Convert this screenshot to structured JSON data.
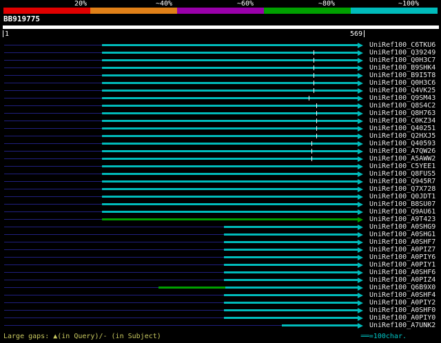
{
  "header": {
    "query_name": "BB919775",
    "ruler_start": "1",
    "ruler_end": "569"
  },
  "scalebar": {
    "segments": [
      {
        "label": "20%",
        "color": "#e00000"
      },
      {
        "label": "~40%",
        "color": "#e08018"
      },
      {
        "label": "~60%",
        "color": "#9900aa"
      },
      {
        "label": "~80%",
        "color": "#00a000"
      },
      {
        "label": "~100%",
        "color": "#00bbbb"
      }
    ]
  },
  "colors": {
    "unaligned": "#202080",
    "gap_mark": "#f0f0f0",
    "query_bar": "#ffffff"
  },
  "footer": {
    "large_gaps": "Large gaps: ▲(in Query)/- (in Subject)",
    "ruler_icon": "══",
    "ruler_text": "=100char."
  },
  "chart_data": {
    "type": "bar",
    "subtype": "blast-alignment-overview",
    "title": "BB919775",
    "xlabel": "query position",
    "x_range": [
      1,
      569
    ],
    "legend_position": "top",
    "identity_bins": [
      {
        "label": "20%",
        "color": "#e00000"
      },
      {
        "label": "~40%",
        "color": "#e08018"
      },
      {
        "label": "~60%",
        "color": "#9900aa"
      },
      {
        "label": "~80%",
        "color": "#00a000"
      },
      {
        "label": "~100%",
        "color": "#00bbbb"
      }
    ],
    "hits": [
      {
        "label": "UniRef100_C6TKU6",
        "segments": [
          {
            "from": 156,
            "to": 569,
            "bin": "~100%"
          }
        ],
        "gap_marks": []
      },
      {
        "label": "UniRef100_Q39249",
        "segments": [
          {
            "from": 156,
            "to": 569,
            "bin": "~100%"
          }
        ],
        "gap_marks": [
          490
        ]
      },
      {
        "label": "UniRef100_Q0H3C7",
        "segments": [
          {
            "from": 156,
            "to": 569,
            "bin": "~100%"
          }
        ],
        "gap_marks": [
          490
        ]
      },
      {
        "label": "UniRef100_B9SHK4",
        "segments": [
          {
            "from": 156,
            "to": 569,
            "bin": "~100%"
          }
        ],
        "gap_marks": [
          490
        ]
      },
      {
        "label": "UniRef100_B9I5T8",
        "segments": [
          {
            "from": 156,
            "to": 569,
            "bin": "~100%"
          }
        ],
        "gap_marks": [
          490
        ]
      },
      {
        "label": "UniRef100_Q0H3C6",
        "segments": [
          {
            "from": 156,
            "to": 569,
            "bin": "~100%"
          }
        ],
        "gap_marks": [
          490
        ]
      },
      {
        "label": "UniRef100_Q4VK25",
        "segments": [
          {
            "from": 156,
            "to": 569,
            "bin": "~100%"
          }
        ],
        "gap_marks": [
          490
        ]
      },
      {
        "label": "UniRef100_Q9SM43",
        "segments": [
          {
            "from": 156,
            "to": 569,
            "bin": "~100%"
          }
        ],
        "gap_marks": [
          483
        ]
      },
      {
        "label": "UniRef100_Q8S4C2",
        "segments": [
          {
            "from": 156,
            "to": 569,
            "bin": "~100%"
          }
        ],
        "gap_marks": [
          495
        ]
      },
      {
        "label": "UniRef100_Q8H763",
        "segments": [
          {
            "from": 156,
            "to": 569,
            "bin": "~100%"
          }
        ],
        "gap_marks": [
          495
        ]
      },
      {
        "label": "UniRef100_C0KZ34",
        "segments": [
          {
            "from": 156,
            "to": 569,
            "bin": "~100%"
          }
        ],
        "gap_marks": [
          495
        ]
      },
      {
        "label": "UniRef100_Q40251",
        "segments": [
          {
            "from": 156,
            "to": 569,
            "bin": "~100%"
          }
        ],
        "gap_marks": [
          495
        ]
      },
      {
        "label": "UniRef100_Q2HXJ5",
        "segments": [
          {
            "from": 156,
            "to": 569,
            "bin": "~100%"
          }
        ],
        "gap_marks": [
          495
        ]
      },
      {
        "label": "UniRef100_Q40593",
        "segments": [
          {
            "from": 156,
            "to": 569,
            "bin": "~100%"
          }
        ],
        "gap_marks": [
          487
        ]
      },
      {
        "label": "UniRef100_A7QW26",
        "segments": [
          {
            "from": 156,
            "to": 569,
            "bin": "~100%"
          }
        ],
        "gap_marks": [
          487
        ]
      },
      {
        "label": "UniRef100_A5AWW2",
        "segments": [
          {
            "from": 156,
            "to": 569,
            "bin": "~100%"
          }
        ],
        "gap_marks": [
          487
        ]
      },
      {
        "label": "UniRef100_C5YEE1",
        "segments": [
          {
            "from": 156,
            "to": 569,
            "bin": "~100%"
          }
        ],
        "gap_marks": []
      },
      {
        "label": "UniRef100_Q8FUS5",
        "segments": [
          {
            "from": 156,
            "to": 569,
            "bin": "~100%"
          }
        ],
        "gap_marks": []
      },
      {
        "label": "UniRef100_Q945R7",
        "segments": [
          {
            "from": 156,
            "to": 569,
            "bin": "~100%"
          }
        ],
        "gap_marks": []
      },
      {
        "label": "UniRef100_Q7X728",
        "segments": [
          {
            "from": 156,
            "to": 569,
            "bin": "~100%"
          }
        ],
        "gap_marks": []
      },
      {
        "label": "UniRef100_Q0JDT1",
        "segments": [
          {
            "from": 156,
            "to": 569,
            "bin": "~100%"
          }
        ],
        "gap_marks": []
      },
      {
        "label": "UniRef100_B8SU07",
        "segments": [
          {
            "from": 156,
            "to": 569,
            "bin": "~100%"
          }
        ],
        "gap_marks": []
      },
      {
        "label": "UniRef100_Q9AU61",
        "segments": [
          {
            "from": 156,
            "to": 569,
            "bin": "~100%"
          }
        ],
        "gap_marks": []
      },
      {
        "label": "UniRef100_A9T423",
        "segments": [
          {
            "from": 156,
            "to": 569,
            "bin": "~80%"
          }
        ],
        "gap_marks": []
      },
      {
        "label": "UniRef100_A0SHG9",
        "segments": [
          {
            "from": 349,
            "to": 569,
            "bin": "~100%"
          }
        ],
        "gap_marks": []
      },
      {
        "label": "UniRef100_A0SHG1",
        "segments": [
          {
            "from": 349,
            "to": 569,
            "bin": "~100%"
          }
        ],
        "gap_marks": []
      },
      {
        "label": "UniRef100_A0SHF7",
        "segments": [
          {
            "from": 349,
            "to": 569,
            "bin": "~100%"
          }
        ],
        "gap_marks": []
      },
      {
        "label": "UniRef100_A0PIZ7",
        "segments": [
          {
            "from": 349,
            "to": 569,
            "bin": "~100%"
          }
        ],
        "gap_marks": []
      },
      {
        "label": "UniRef100_A0PIY6",
        "segments": [
          {
            "from": 349,
            "to": 569,
            "bin": "~100%"
          }
        ],
        "gap_marks": []
      },
      {
        "label": "UniRef100_A0PIY1",
        "segments": [
          {
            "from": 349,
            "to": 569,
            "bin": "~100%"
          }
        ],
        "gap_marks": []
      },
      {
        "label": "UniRef100_A0SHF6",
        "segments": [
          {
            "from": 349,
            "to": 569,
            "bin": "~100%"
          }
        ],
        "gap_marks": []
      },
      {
        "label": "UniRef100_A0PIZ4",
        "segments": [
          {
            "from": 349,
            "to": 569,
            "bin": "~100%"
          }
        ],
        "gap_marks": []
      },
      {
        "label": "UniRef100_Q6B9X0",
        "segments": [
          {
            "from": 245,
            "to": 351,
            "bin": "~80%"
          },
          {
            "from": 351,
            "to": 569,
            "bin": "~100%"
          }
        ],
        "gap_marks": []
      },
      {
        "label": "UniRef100_A0SHF4",
        "segments": [
          {
            "from": 349,
            "to": 569,
            "bin": "~100%"
          }
        ],
        "gap_marks": []
      },
      {
        "label": "UniRef100_A0PIY2",
        "segments": [
          {
            "from": 349,
            "to": 569,
            "bin": "~100%"
          }
        ],
        "gap_marks": []
      },
      {
        "label": "UniRef100_A0SHF0",
        "segments": [
          {
            "from": 349,
            "to": 569,
            "bin": "~100%"
          }
        ],
        "gap_marks": []
      },
      {
        "label": "UniRef100_A0PIY0",
        "segments": [
          {
            "from": 349,
            "to": 569,
            "bin": "~100%"
          }
        ],
        "gap_marks": []
      },
      {
        "label": "UniRef100_A7UNK2",
        "segments": [
          {
            "from": 440,
            "to": 569,
            "bin": "~100%"
          }
        ],
        "gap_marks": []
      }
    ]
  }
}
